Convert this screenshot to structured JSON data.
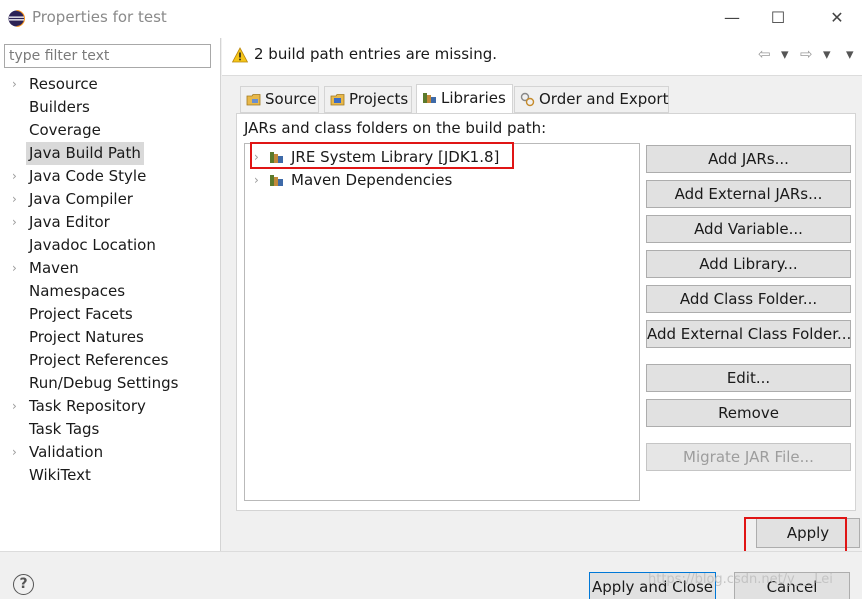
{
  "window": {
    "title": "Properties for test",
    "minimize_glyph": "—",
    "maximize_glyph": "☐",
    "close_glyph": "✕",
    "app_icon": "eclipse-icon"
  },
  "sidebar": {
    "filter_placeholder": "type filter text",
    "items": [
      {
        "label": "Resource",
        "expandable": true
      },
      {
        "label": "Builders",
        "expandable": false
      },
      {
        "label": "Coverage",
        "expandable": false
      },
      {
        "label": "Java Build Path",
        "expandable": false,
        "selected": true
      },
      {
        "label": "Java Code Style",
        "expandable": true
      },
      {
        "label": "Java Compiler",
        "expandable": true
      },
      {
        "label": "Java Editor",
        "expandable": true
      },
      {
        "label": "Javadoc Location",
        "expandable": false
      },
      {
        "label": "Maven",
        "expandable": true
      },
      {
        "label": "Namespaces",
        "expandable": false
      },
      {
        "label": "Project Facets",
        "expandable": false
      },
      {
        "label": "Project Natures",
        "expandable": false
      },
      {
        "label": "Project References",
        "expandable": false
      },
      {
        "label": "Run/Debug Settings",
        "expandable": false
      },
      {
        "label": "Task Repository",
        "expandable": true
      },
      {
        "label": "Task Tags",
        "expandable": false
      },
      {
        "label": "Validation",
        "expandable": true
      },
      {
        "label": "WikiText",
        "expandable": false
      }
    ]
  },
  "header": {
    "message": "2 build path entries are missing.",
    "icon": "warning-icon",
    "nav_back": "⇦",
    "nav_forward": "⇨",
    "dropdown_glyph": "▾"
  },
  "tabs": [
    {
      "label": "Source",
      "icon": "source-folder-icon"
    },
    {
      "label": "Projects",
      "icon": "projects-icon"
    },
    {
      "label": "Libraries",
      "icon": "libraries-icon",
      "active": true
    },
    {
      "label": "Order and Export",
      "icon": "order-export-icon"
    }
  ],
  "libraries": {
    "caption": "JARs and class folders on the build path:",
    "entries": [
      {
        "label": "JRE System Library [JDK1.8]",
        "highlighted": true
      },
      {
        "label": "Maven Dependencies",
        "highlighted": false
      }
    ]
  },
  "buttons": {
    "add_jars": "Add JARs...",
    "add_external_jars": "Add External JARs...",
    "add_variable": "Add Variable...",
    "add_library": "Add Library...",
    "add_class_folder": "Add Class Folder...",
    "add_external_class_folder": "Add External Class Folder...",
    "edit": "Edit...",
    "remove": "Remove",
    "migrate_jar": "Migrate JAR File..."
  },
  "footer": {
    "apply": "Apply",
    "apply_and_close": "Apply and Close",
    "cancel": "Cancel",
    "help_glyph": "?",
    "watermark": "https://blog.csdn.net/y___Lei"
  },
  "colors": {
    "highlight_red": "#e01515",
    "selected_bg": "#d9d9d9"
  }
}
